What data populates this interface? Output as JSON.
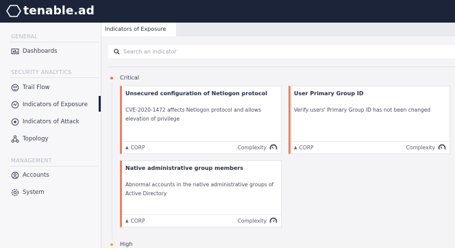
{
  "app": {
    "brand": "tenable.ad"
  },
  "sidebar": {
    "sections": [
      {
        "title": "GENERAL"
      },
      {
        "title": "SECURITY ANALYTICS"
      },
      {
        "title": "MANAGEMENT"
      }
    ],
    "items": [
      {
        "label": "Dashboards",
        "icon": "dashboard-icon"
      },
      {
        "label": "Trail Flow",
        "icon": "trail-flow-icon"
      },
      {
        "label": "Indicators of Exposure",
        "icon": "exposure-icon",
        "active": true
      },
      {
        "label": "Indicators of Attack",
        "icon": "attack-icon"
      },
      {
        "label": "Topology",
        "icon": "topology-icon"
      },
      {
        "label": "Accounts",
        "icon": "accounts-icon"
      },
      {
        "label": "System",
        "icon": "system-icon"
      }
    ]
  },
  "tabs": [
    {
      "label": "Indicators of Exposure"
    }
  ],
  "search": {
    "placeholder": "Search an indicator",
    "value": ""
  },
  "severities": [
    {
      "label": "Critical",
      "color": "#f0743a"
    },
    {
      "label": "High",
      "color": "#f5a623"
    }
  ],
  "cards": [
    {
      "title": "Unsecured configuration of Netlogon protocol",
      "description": "CVE-2020-1472 affects Netlogon protocol and allows elevation of privilege",
      "domain": "CORP",
      "complexity_label": "Complexity"
    },
    {
      "title": "User Primary Group ID",
      "description": "Verify users' Primary Group ID has not been changed",
      "domain": "CORP",
      "complexity_label": "Complexity"
    },
    {
      "title": "Native administrative group members",
      "description": "Abnormal accounts in the native administrative groups of Active Directory",
      "domain": "CORP",
      "complexity_label": "Complexity"
    }
  ],
  "colors": {
    "topbar": "#1c2439",
    "critical_accent": "#f08060"
  }
}
